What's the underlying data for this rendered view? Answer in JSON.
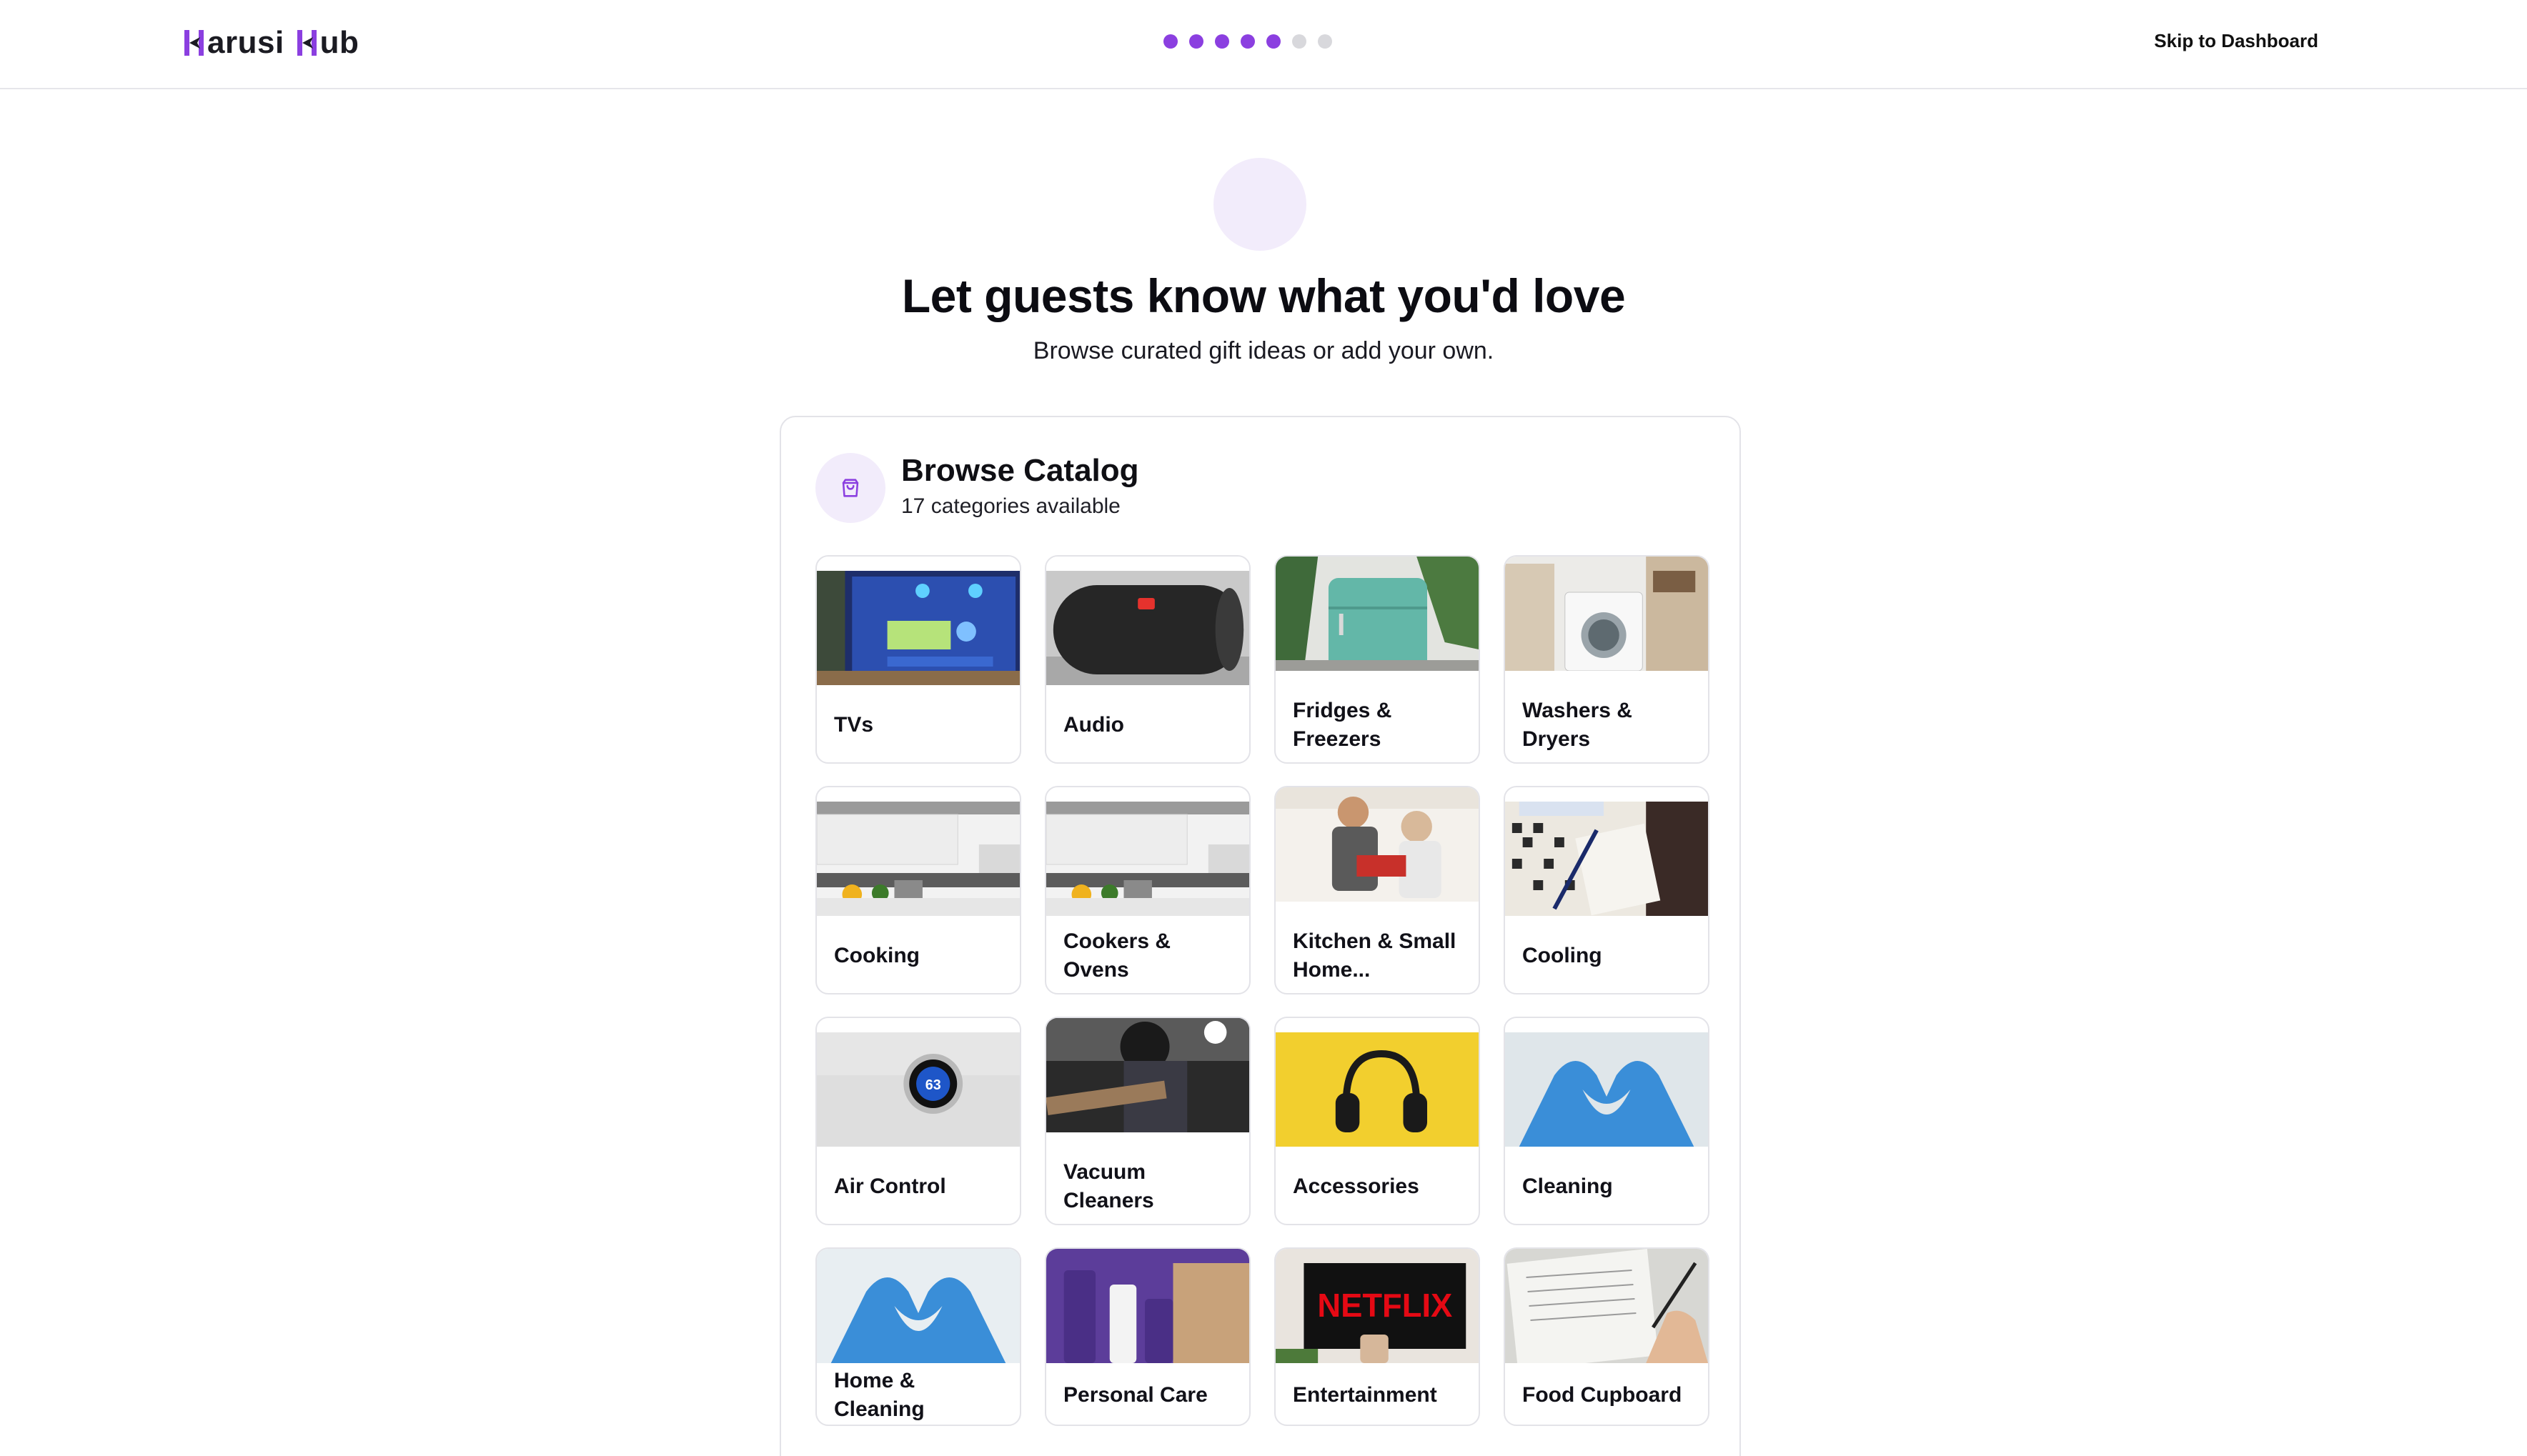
{
  "header": {
    "logo_text_1": "arusi",
    "logo_text_2": "ub",
    "skip_label": "Skip to Dashboard",
    "progress": {
      "total_steps": 7,
      "completed_steps": 5
    }
  },
  "hero": {
    "title": "Let guests know what you'd love",
    "subtitle": "Browse curated gift ideas or add your own."
  },
  "catalog": {
    "title": "Browse Catalog",
    "count_text": "17 categories available",
    "icon": "shopping-bag-icon",
    "accent_color": "#8b3fe0",
    "categories": [
      {
        "label": "TVs",
        "image": "tv-image"
      },
      {
        "label": "Audio",
        "image": "speaker-image"
      },
      {
        "label": "Fridges & Freezers",
        "image": "fridge-image"
      },
      {
        "label": "Washers & Dryers",
        "image": "washer-image"
      },
      {
        "label": "Cooking",
        "image": "kitchen-image"
      },
      {
        "label": "Cookers & Ovens",
        "image": "kitchen-image"
      },
      {
        "label": "Kitchen & Small Home...",
        "image": "people-kitchen-image"
      },
      {
        "label": "Cooling",
        "image": "crossword-image"
      },
      {
        "label": "Air Control",
        "image": "thermostat-image"
      },
      {
        "label": "Vacuum Cleaners",
        "image": "welder-image"
      },
      {
        "label": "Accessories",
        "image": "headphones-image"
      },
      {
        "label": "Cleaning",
        "image": "glove-heart-image"
      },
      {
        "label": "Home & Cleaning",
        "image": "glove-heart-image"
      },
      {
        "label": "Personal Care",
        "image": "cosmetics-image"
      },
      {
        "label": "Entertainment",
        "image": "netflix-image"
      },
      {
        "label": "Food Cupboard",
        "image": "notebook-image"
      }
    ],
    "thermostat_readout": "63",
    "netflix_text": "NETFLIX"
  }
}
